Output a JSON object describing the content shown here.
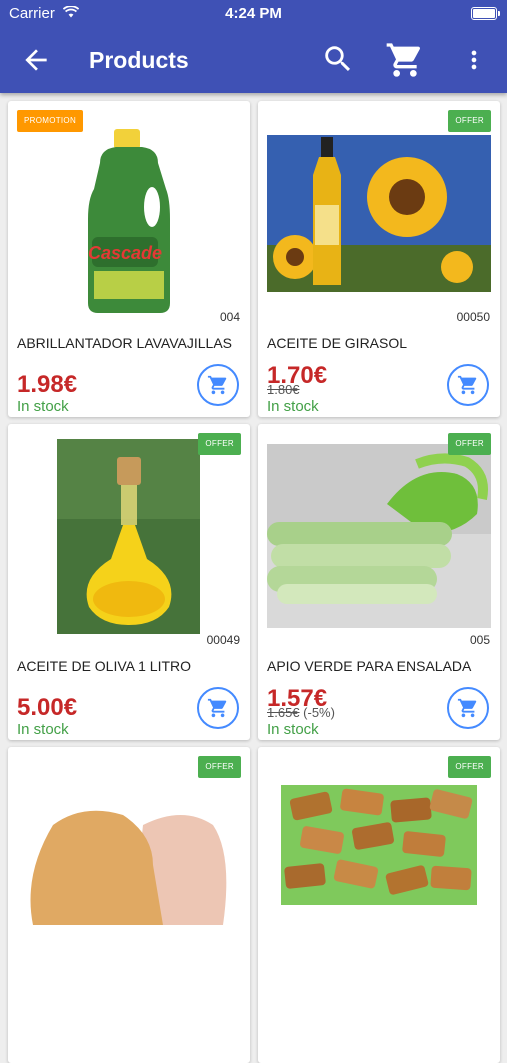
{
  "status": {
    "carrier": "Carrier",
    "time": "4:24 PM"
  },
  "toolbar": {
    "title": "Products"
  },
  "icons": {
    "back": "arrow-back-icon",
    "search": "search-icon",
    "cart": "cart-icon",
    "more": "more-vert-icon",
    "add": "add-to-cart-icon"
  },
  "colors": {
    "primary": "#3f51b5",
    "price": "#c62828",
    "stock": "#43a047",
    "offer": "#4caf50",
    "promotion": "#ff9800",
    "cart_button": "#448aff"
  },
  "products": [
    {
      "badge": "PROMOTION",
      "code": "004",
      "name": "ABRILLANTADOR LAVAVAJILLAS",
      "price": "1.98€",
      "old_price": "",
      "discount": "",
      "stock": "In stock"
    },
    {
      "badge": "OFFER",
      "code": "00050",
      "name": "ACEITE DE GIRASOL",
      "price": "1.70€",
      "old_price": "1.80€",
      "discount": "",
      "stock": "In stock"
    },
    {
      "badge": "OFFER",
      "code": "00049",
      "name": "ACEITE DE OLIVA 1 LITRO",
      "price": "5.00€",
      "old_price": "",
      "discount": "",
      "stock": "In stock"
    },
    {
      "badge": "OFFER",
      "code": "005",
      "name": "APIO VERDE PARA ENSALADA",
      "price": "1.57€",
      "old_price": "1.65€",
      "discount": "(-5%)",
      "stock": "In stock"
    },
    {
      "badge": "OFFER"
    },
    {
      "badge": "OFFER"
    }
  ]
}
